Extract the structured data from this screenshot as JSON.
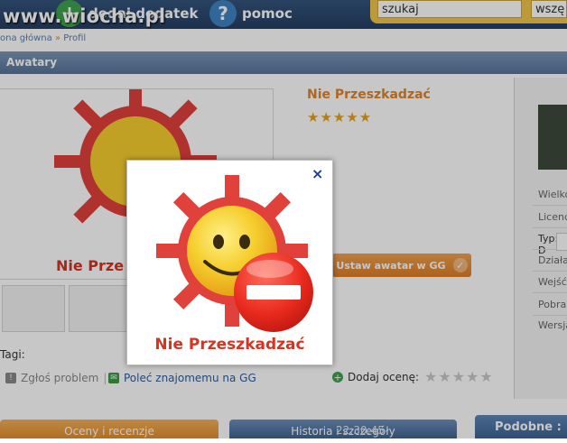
{
  "site": {
    "logo_text": "www.wiocha.pl",
    "nav_add": "dodaj dodatek",
    "nav_help": "pomoc",
    "search_value": "szukaj",
    "search_scope": "wszę"
  },
  "breadcrumb": {
    "home": "ona główna",
    "sep": "»",
    "current": "Profil"
  },
  "section_title": "Awatary",
  "avatar": {
    "name": "Nie Przeszkadzać",
    "name_partial": "Nie Prze",
    "rating": 5,
    "set_button": "Ustaw awatar w GG"
  },
  "info_labels": [
    "Wielko",
    "Licencj",
    "Typ: D",
    "Działa",
    "Wejść",
    "Pobrań",
    "Wersja"
  ],
  "tags_label": "Tagi:",
  "actions": {
    "report": "Zgłoś problem",
    "recommend": "Poleć znajomemu na GG",
    "rate": "Dodaj ocenę:"
  },
  "tabs": {
    "reviews": "Oceny i recenzje",
    "history": "Historia i szczegóły",
    "timestamp": "22:30:45",
    "similar": "Podobne :"
  },
  "modal": {
    "caption": "Nie Przeszkadzać",
    "close": "×"
  },
  "colors": {
    "accent_orange": "#e0852a",
    "header_blue": "#55739a",
    "sun_red": "#e0413b",
    "sun_yellow": "#f6cf2f"
  },
  "icons": {
    "add": "plus-icon",
    "help": "question-icon",
    "close": "close-icon",
    "check": "check-icon"
  }
}
